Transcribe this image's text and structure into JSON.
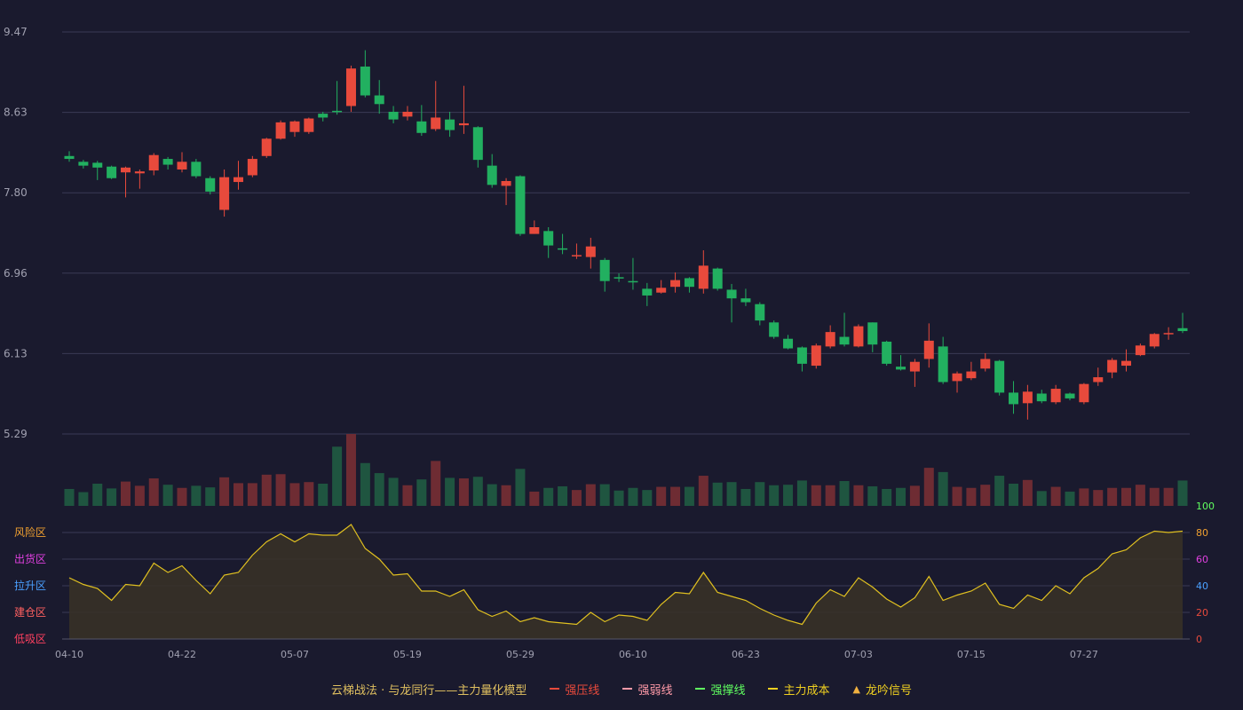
{
  "colors": {
    "background": "#1a1a2e",
    "up": "#e84a3c",
    "down": "#22b060",
    "up_volume": "#6e2c33",
    "down_volume": "#1f5540",
    "grid": "#3a3a55",
    "axis_text": "#a0a0b0",
    "cost_line": "#e0c020",
    "cost_fill": "#3a3326"
  },
  "chart_data": [
    {
      "type": "candlestick",
      "title": "",
      "y_ticks": [
        "9.47",
        "8.63",
        "7.80",
        "6.96",
        "6.13",
        "5.29"
      ],
      "ylim": [
        5.29,
        9.47
      ],
      "grid": true,
      "x_labels": [
        "04-10",
        "04-22",
        "05-07",
        "05-19",
        "05-29",
        "06-10",
        "06-23",
        "07-03",
        "07-15",
        "07-27"
      ],
      "x_label_index": [
        0,
        8,
        16,
        24,
        32,
        40,
        48,
        56,
        64,
        72
      ],
      "candles": [
        [
          8.18,
          8.15,
          8.23,
          8.12
        ],
        [
          8.12,
          8.08,
          8.14,
          8.05
        ],
        [
          8.11,
          8.06,
          8.13,
          7.93
        ],
        [
          8.07,
          7.95,
          8.08,
          7.94
        ],
        [
          8.01,
          8.06,
          8.07,
          7.75
        ],
        [
          8.0,
          8.02,
          8.04,
          7.84
        ],
        [
          8.03,
          8.19,
          8.21,
          7.98
        ],
        [
          8.15,
          8.09,
          8.17,
          8.04
        ],
        [
          8.04,
          8.12,
          8.22,
          8.01
        ],
        [
          8.12,
          7.97,
          8.15,
          7.95
        ],
        [
          7.95,
          7.81,
          7.97,
          7.78
        ],
        [
          7.62,
          7.96,
          8.04,
          7.55
        ],
        [
          7.91,
          7.96,
          8.13,
          7.83
        ],
        [
          7.98,
          8.15,
          8.18,
          7.96
        ],
        [
          8.18,
          8.36,
          8.37,
          8.16
        ],
        [
          8.36,
          8.53,
          8.55,
          8.35
        ],
        [
          8.43,
          8.54,
          8.55,
          8.38
        ],
        [
          8.43,
          8.57,
          8.58,
          8.41
        ],
        [
          8.62,
          8.58,
          8.64,
          8.54
        ],
        [
          8.65,
          8.64,
          8.96,
          8.61
        ],
        [
          8.7,
          9.09,
          9.12,
          8.64
        ],
        [
          9.11,
          8.81,
          9.28,
          8.79
        ],
        [
          8.81,
          8.72,
          8.97,
          8.62
        ],
        [
          8.64,
          8.56,
          8.7,
          8.52
        ],
        [
          8.59,
          8.64,
          8.7,
          8.55
        ],
        [
          8.54,
          8.42,
          8.71,
          8.39
        ],
        [
          8.46,
          8.58,
          8.96,
          8.44
        ],
        [
          8.56,
          8.45,
          8.64,
          8.38
        ],
        [
          8.5,
          8.52,
          8.91,
          8.41
        ],
        [
          8.48,
          8.14,
          8.49,
          8.06
        ],
        [
          8.08,
          7.88,
          8.2,
          7.85
        ],
        [
          7.87,
          7.92,
          7.95,
          7.67
        ],
        [
          7.97,
          7.37,
          7.98,
          7.35
        ],
        [
          7.37,
          7.44,
          7.51,
          7.37
        ],
        [
          7.4,
          7.25,
          7.44,
          7.12
        ],
        [
          7.22,
          7.21,
          7.37,
          7.16
        ],
        [
          7.15,
          7.15,
          7.27,
          7.11
        ],
        [
          7.13,
          7.24,
          7.33,
          7.01
        ],
        [
          7.1,
          6.88,
          7.12,
          6.77
        ],
        [
          6.92,
          6.91,
          6.96,
          6.87
        ],
        [
          6.88,
          6.87,
          7.12,
          6.79
        ],
        [
          6.8,
          6.73,
          6.86,
          6.62
        ],
        [
          6.76,
          6.81,
          6.89,
          6.75
        ],
        [
          6.82,
          6.89,
          6.97,
          6.76
        ],
        [
          6.91,
          6.82,
          6.92,
          6.76
        ],
        [
          6.8,
          7.04,
          7.2,
          6.75
        ],
        [
          7.01,
          6.8,
          7.02,
          6.78
        ],
        [
          6.79,
          6.7,
          6.85,
          6.45
        ],
        [
          6.7,
          6.66,
          6.8,
          6.62
        ],
        [
          6.64,
          6.47,
          6.66,
          6.42
        ],
        [
          6.45,
          6.3,
          6.47,
          6.28
        ],
        [
          6.28,
          6.18,
          6.32,
          6.17
        ],
        [
          6.19,
          6.02,
          6.2,
          5.94
        ],
        [
          6.0,
          6.21,
          6.23,
          5.97
        ],
        [
          6.2,
          6.35,
          6.42,
          6.18
        ],
        [
          6.3,
          6.22,
          6.55,
          6.2
        ],
        [
          6.2,
          6.41,
          6.43,
          6.19
        ],
        [
          6.45,
          6.22,
          6.45,
          6.14
        ],
        [
          6.25,
          6.02,
          6.26,
          6.0
        ],
        [
          5.99,
          5.96,
          6.11,
          5.95
        ],
        [
          5.94,
          6.04,
          6.07,
          5.78
        ],
        [
          6.07,
          6.26,
          6.44,
          5.98
        ],
        [
          6.2,
          5.83,
          6.3,
          5.81
        ],
        [
          5.84,
          5.92,
          5.94,
          5.72
        ],
        [
          5.87,
          5.94,
          6.04,
          5.85
        ],
        [
          5.97,
          6.07,
          6.13,
          5.94
        ],
        [
          6.05,
          5.72,
          6.06,
          5.69
        ],
        [
          5.72,
          5.6,
          5.84,
          5.5
        ],
        [
          5.61,
          5.73,
          5.8,
          5.44
        ],
        [
          5.71,
          5.63,
          5.75,
          5.61
        ],
        [
          5.62,
          5.76,
          5.8,
          5.6
        ],
        [
          5.71,
          5.66,
          5.72,
          5.64
        ],
        [
          5.62,
          5.81,
          5.82,
          5.6
        ],
        [
          5.83,
          5.88,
          5.98,
          5.79
        ],
        [
          5.93,
          6.06,
          6.08,
          5.87
        ],
        [
          6.0,
          6.05,
          6.17,
          5.94
        ],
        [
          6.11,
          6.21,
          6.23,
          6.1
        ],
        [
          6.2,
          6.33,
          6.34,
          6.18
        ],
        [
          6.33,
          6.34,
          6.4,
          6.27
        ],
        [
          6.39,
          6.36,
          6.55,
          6.34
        ]
      ]
    },
    {
      "type": "bar",
      "name": "volume",
      "values": [
        32,
        26,
        42,
        33,
        46,
        38,
        52,
        40,
        34,
        38,
        35,
        54,
        43,
        43,
        59,
        60,
        43,
        45,
        42,
        112,
        136,
        81,
        62,
        53,
        39,
        50,
        85,
        53,
        52,
        55,
        41,
        39,
        70,
        27,
        34,
        37,
        30,
        41,
        41,
        29,
        34,
        30,
        36,
        36,
        36,
        57,
        44,
        45,
        32,
        45,
        39,
        40,
        48,
        39,
        39,
        47,
        39,
        37,
        32,
        34,
        38,
        72,
        64,
        36,
        34,
        40,
        57,
        42,
        49,
        28,
        36,
        27,
        33,
        30,
        34,
        34,
        40,
        34,
        34,
        48
      ]
    },
    {
      "type": "area",
      "name": "主力成本",
      "y_ticks": [
        "100",
        "80",
        "60",
        "40",
        "20",
        "0"
      ],
      "ylim": [
        0,
        100
      ],
      "zones": [
        "风险区",
        "出货区",
        "拉升区",
        "建仓区",
        "低吸区"
      ],
      "values": [
        46,
        41,
        38,
        29,
        41,
        40,
        57,
        50,
        55,
        44,
        34,
        48,
        50,
        63,
        73,
        79,
        73,
        79,
        78,
        78,
        86,
        68,
        60,
        48,
        49,
        36,
        36,
        32,
        37,
        22,
        17,
        21,
        13,
        16,
        13,
        12,
        11,
        20,
        13,
        18,
        17,
        14,
        26,
        35,
        34,
        50,
        35,
        32,
        29,
        23,
        18,
        14,
        11,
        27,
        37,
        32,
        46,
        39,
        30,
        24,
        31,
        47,
        29,
        33,
        36,
        42,
        26,
        23,
        33,
        29,
        40,
        34,
        46,
        53,
        64,
        67,
        76,
        81,
        80,
        81
      ]
    }
  ],
  "legend": {
    "title": "云梯战法 · 与龙同行——主力量化模型",
    "items": [
      {
        "label": "强压线",
        "color": "#e84a3c",
        "style": "solid"
      },
      {
        "label": "强弱线",
        "color": "#ff9aa8",
        "style": "dashed"
      },
      {
        "label": "强撑线",
        "color": "#60ff60",
        "style": "solid"
      },
      {
        "label": "主力成本",
        "color": "#f0d020",
        "style": "dashed"
      },
      {
        "label": "龙吟信号",
        "color": "#f0b040",
        "style": "triangle"
      }
    ]
  }
}
